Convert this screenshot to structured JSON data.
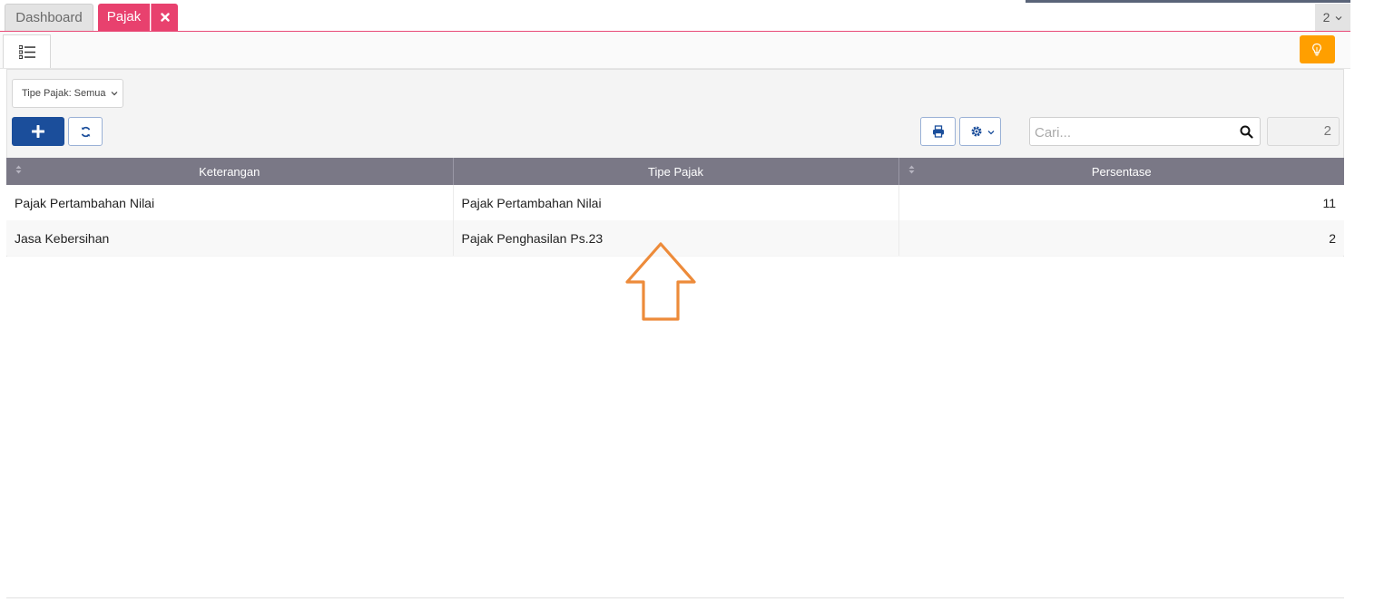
{
  "tabs": [
    {
      "label": "Dashboard"
    },
    {
      "label": "Pajak"
    }
  ],
  "tab_count": "2",
  "filter": {
    "label": "Tipe Pajak: Semua"
  },
  "search": {
    "placeholder": "Cari..."
  },
  "record_count": "2",
  "table": {
    "headers": [
      "Keterangan",
      "Tipe Pajak",
      "Persentase"
    ],
    "rows": [
      [
        "Pajak Pertambahan Nilai",
        "Pajak Pertambahan Nilai",
        "11"
      ],
      [
        "Jasa Kebersihan",
        "Pajak Penghasilan Ps.23",
        "2"
      ]
    ]
  },
  "colors": {
    "active_tab": "#e8416e",
    "primary_button": "#1b4e9b",
    "header_bg": "#7a7886",
    "hint_button": "#ff9f00",
    "annotation_arrow": "#ed8b3a"
  },
  "icons": [
    "close-icon",
    "list-menu-icon",
    "lightbulb-icon",
    "plus-icon",
    "refresh-icon",
    "print-icon",
    "gear-icon",
    "search-icon",
    "chevron-down-icon",
    "sort-icon",
    "up-arrow-annotation"
  ]
}
